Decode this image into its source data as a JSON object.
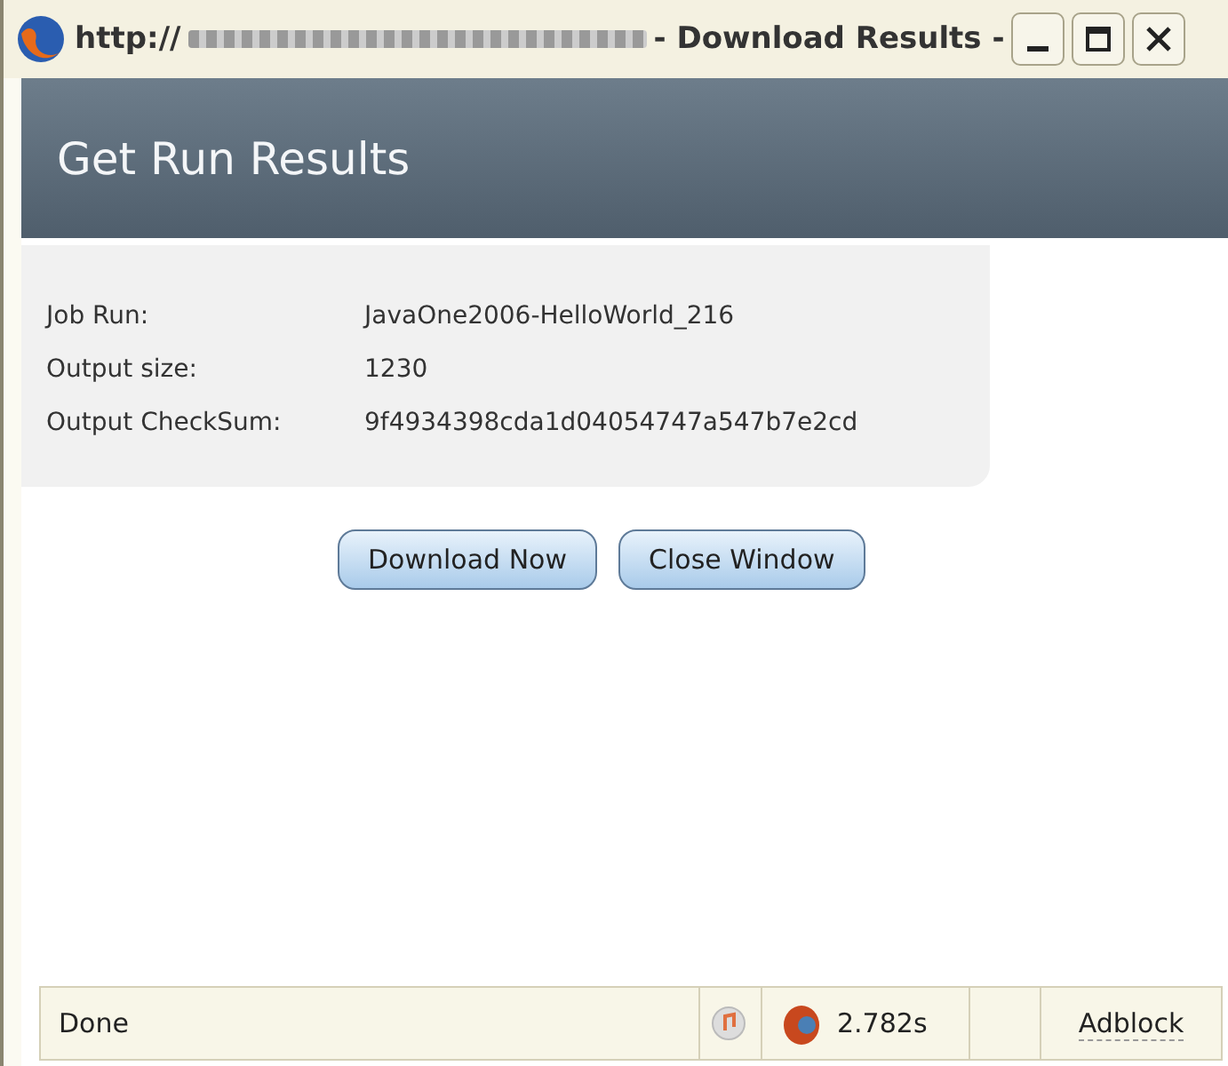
{
  "window": {
    "title_prefix": "http://",
    "title_suffix": "- Download Results -",
    "controls": [
      {
        "kind": "minimize"
      },
      {
        "kind": "maximize"
      },
      {
        "kind": "close"
      }
    ]
  },
  "header": {
    "title": "Get Run Results"
  },
  "details": [
    {
      "label": "Job Run:",
      "value": "JavaOne2006-HelloWorld_216"
    },
    {
      "label": "Output size:",
      "value": "1230"
    },
    {
      "label": "Output CheckSum:",
      "value": "9f4934398cda1d04054747a547b7e2cd"
    }
  ],
  "buttons": [
    "Download Now",
    "Close Window"
  ],
  "status_bar": {
    "status": "Done",
    "timing": "2.782s",
    "adblock": "Adblock"
  }
}
